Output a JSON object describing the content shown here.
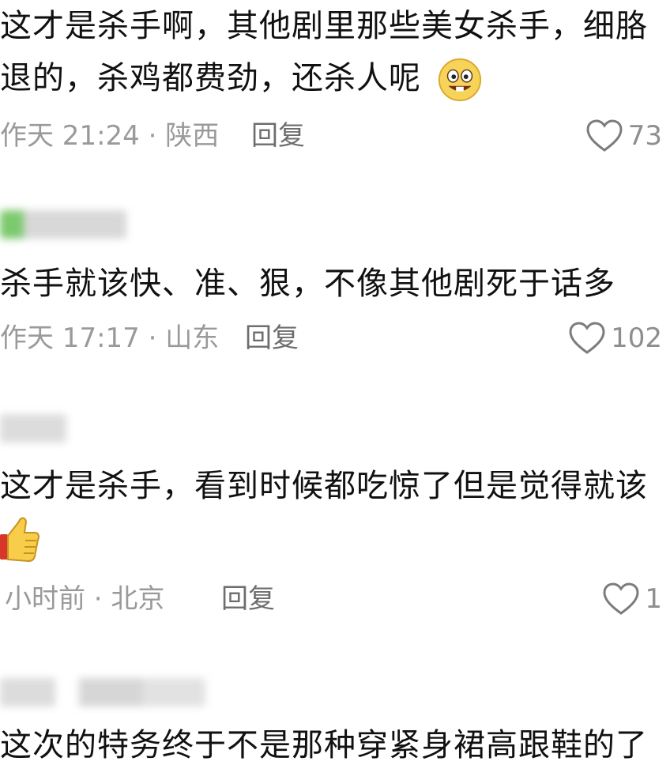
{
  "comments": [
    {
      "line1": "这才是杀手啊，其他剧里那些美女杀手，细胳",
      "line2": "退的，杀鸡都费劲，还杀人呢",
      "emoji": "grin-face-emoji",
      "meta": "作天 21:24 · 陕西",
      "reply": "回复",
      "likes": "73"
    },
    {
      "line1": "杀手就该快、准、狠，不像其他剧死于话多",
      "meta": "作天 17:17 · 山东",
      "reply": "回复",
      "likes": "102"
    },
    {
      "line1": "这才是杀手，看到时候都吃惊了但是觉得就该",
      "emoji": "thumbs-up-emoji",
      "meta": "小时前 · 北京",
      "reply": "回复",
      "likes": "1"
    },
    {
      "line1": "这次的特务终于不是那种穿紧身裙高跟鞋的了"
    }
  ],
  "colors": {
    "text": "#111111",
    "meta": "#9a9a9a",
    "reply": "#6d6d6d",
    "like": "#8e8e8e"
  }
}
